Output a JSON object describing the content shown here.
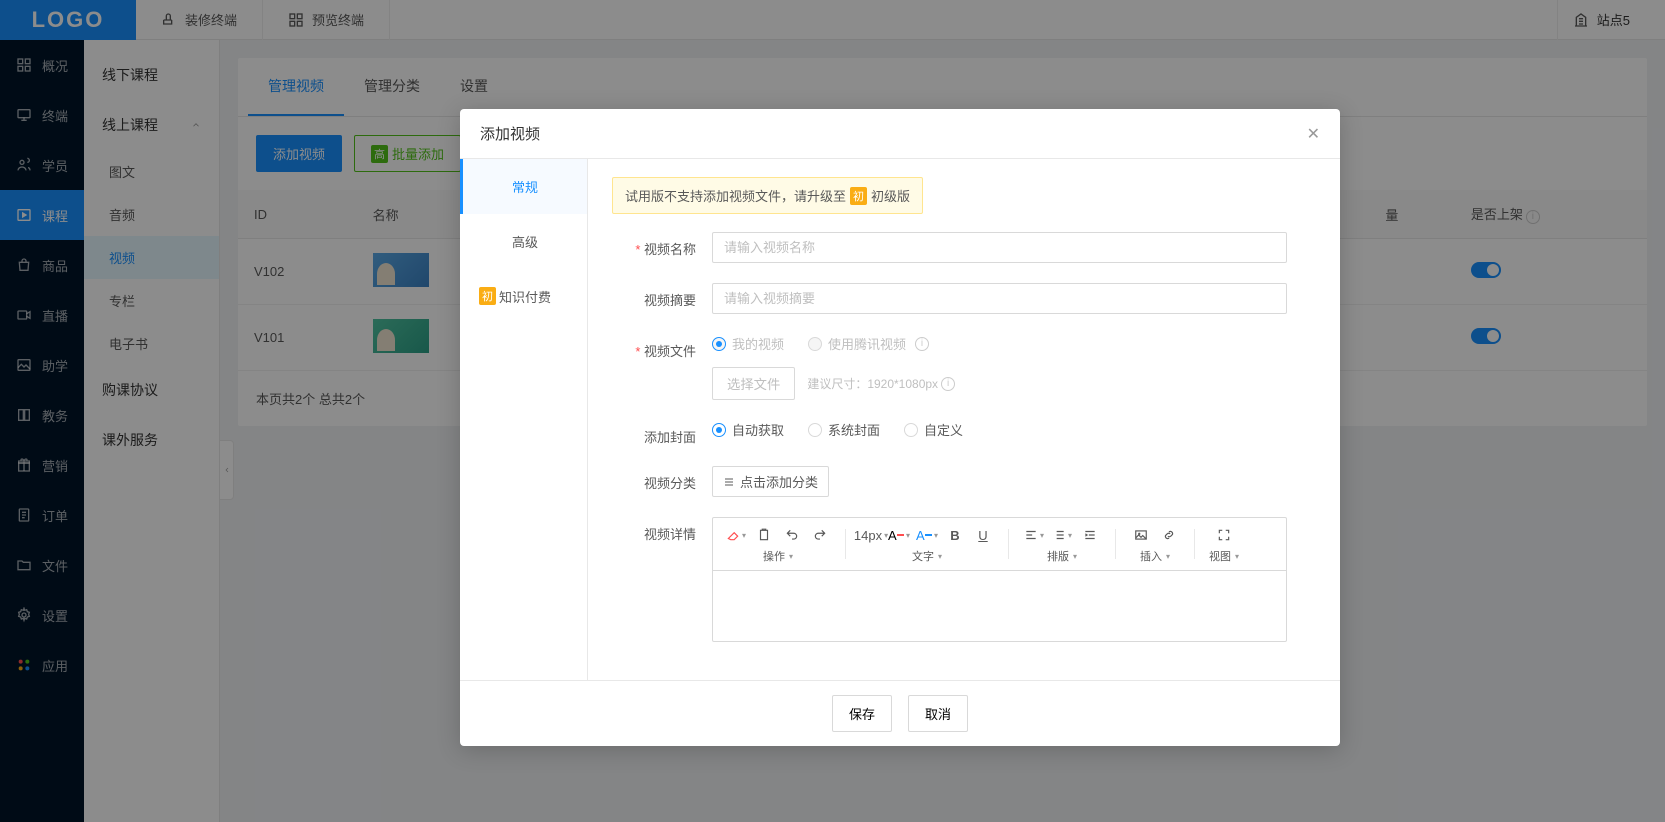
{
  "topbar": {
    "logo": "LOGO",
    "decorate": "装修终端",
    "preview": "预览终端",
    "site": "站点5"
  },
  "nav": {
    "overview": "概况",
    "terminal": "终端",
    "student": "学员",
    "course": "课程",
    "goods": "商品",
    "live": "直播",
    "assist": "助学",
    "edu": "教务",
    "marketing": "营销",
    "order": "订单",
    "file": "文件",
    "setting": "设置",
    "app": "应用"
  },
  "sidebar2": {
    "offline": "线下课程",
    "online": "线上课程",
    "image_text": "图文",
    "audio": "音频",
    "video": "视频",
    "column": "专栏",
    "ebook": "电子书",
    "agreement": "购课协议",
    "extra": "课外服务"
  },
  "tabs": {
    "manage_video": "管理视频",
    "manage_cat": "管理分类",
    "setting": "设置"
  },
  "toolbar": {
    "add": "添加视频",
    "batch_badge": "高",
    "batch": "批量添加"
  },
  "table": {
    "headers": {
      "id": "ID",
      "name": "名称",
      "visits": "量",
      "onsale": "是否上架"
    },
    "rows": [
      {
        "id": "V102"
      },
      {
        "id": "V101"
      }
    ],
    "pager": "本页共2个 总共2个"
  },
  "modal": {
    "title": "添加视频",
    "side": {
      "general": "常规",
      "advanced": "高级",
      "paid_badge": "初",
      "paid": "知识付费"
    },
    "warn_pre": "试用版不支持添加视频文件，请升级至",
    "warn_badge": "初",
    "warn_post": "初级版",
    "labels": {
      "name": "视频名称",
      "name_ph": "请输入视频名称",
      "summary": "视频摘要",
      "summary_ph": "请输入视频摘要",
      "file": "视频文件",
      "my_video": "我的视频",
      "tencent": "使用腾讯视频",
      "choose_file": "选择文件",
      "size_hint": "建议尺寸：1920*1080px",
      "cover": "添加封面",
      "cover_auto": "自动获取",
      "cover_system": "系统封面",
      "cover_custom": "自定义",
      "category": "视频分类",
      "add_cat": "点击添加分类",
      "detail": "视频详情"
    },
    "editor": {
      "font_size": "14px",
      "op": "操作",
      "text": "文字",
      "layout": "排版",
      "insert": "插入",
      "view": "视图"
    },
    "footer": {
      "save": "保存",
      "cancel": "取消"
    }
  }
}
